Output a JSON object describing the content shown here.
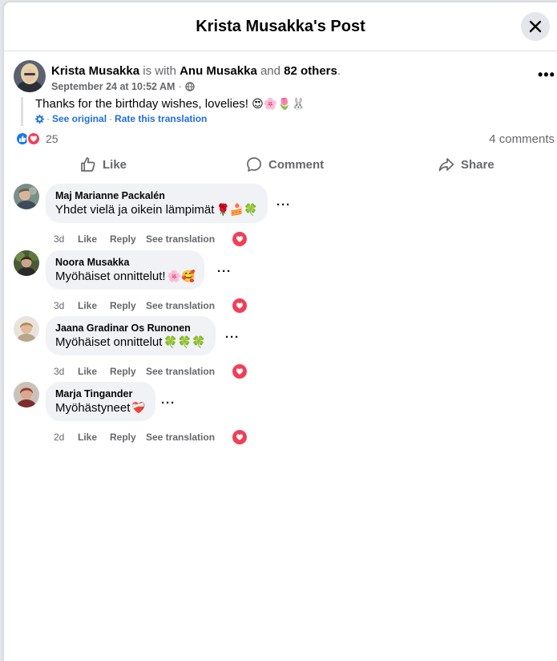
{
  "modal": {
    "title": "Krista Musakka's Post"
  },
  "post": {
    "author": "Krista Musakka",
    "with_text": "is with",
    "tagged": "Anu Musakka",
    "and_text": "and",
    "others": "82 others",
    "period": ".",
    "date": "September 24 at 10:52 AM",
    "dot": "·",
    "text": "Thanks for the birthday wishes, lovelies!",
    "emojis": [
      "😍",
      "🌸",
      "🌷",
      "🐰"
    ],
    "see_original": "See original",
    "separator": "·",
    "rate_translation": "Rate this translation",
    "reaction_count": "25",
    "comments_count": "4 comments",
    "colors": {
      "like": "#1877f2",
      "love": "#f33e58",
      "link": "#216fdb"
    }
  },
  "actions": {
    "like": "Like",
    "comment": "Comment",
    "share": "Share"
  },
  "comments": [
    {
      "name": "Maj Marianne Packalén",
      "text": "Yhdet vielä ja oikein lämpimät",
      "emojis": "🌹🍰🍀",
      "time": "3d",
      "like": "Like",
      "reply": "Reply",
      "translate": "See translation"
    },
    {
      "name": "Noora Musakka",
      "text": "Myöhäiset onnittelut!",
      "emojis": "🌸🥰",
      "time": "3d",
      "like": "Like",
      "reply": "Reply",
      "translate": "See translation"
    },
    {
      "name": "Jaana Gradinar Os Runonen",
      "text": "Myöhäiset onnittelut",
      "emojis": "🍀🍀🍀",
      "time": "3d",
      "like": "Like",
      "reply": "Reply",
      "translate": "See translation"
    },
    {
      "name": "Marja Tingander",
      "text": "Myöhästyneet",
      "emojis": "❤️‍🩹",
      "time": "2d",
      "like": "Like",
      "reply": "Reply",
      "translate": "See translation"
    }
  ]
}
